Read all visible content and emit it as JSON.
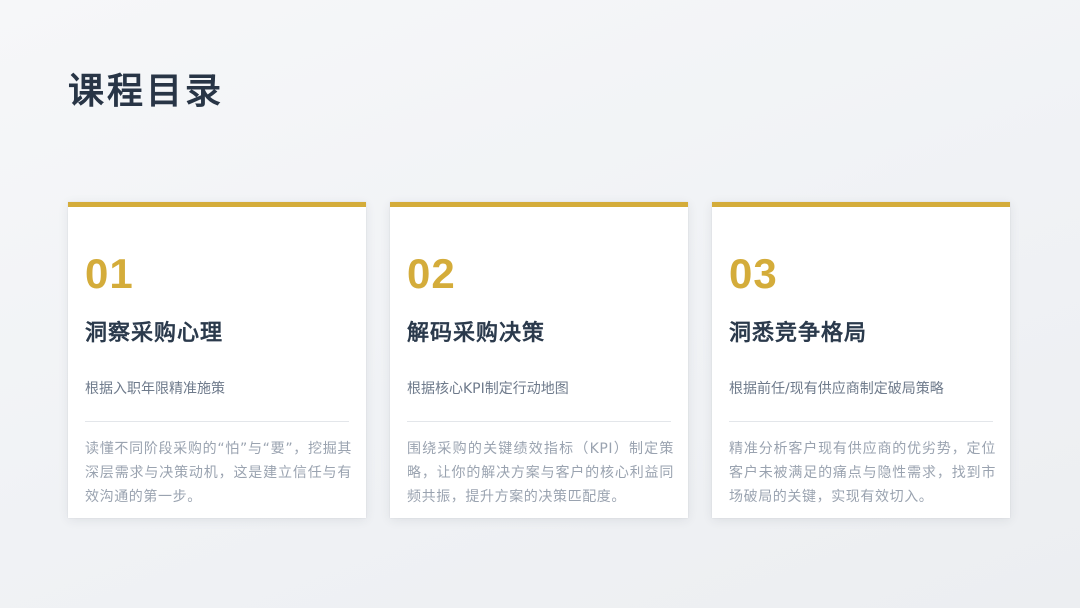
{
  "page": {
    "title": "课程目录"
  },
  "colors": {
    "accent": "#d4ac3a",
    "title": "#283546",
    "heading": "#2b3a4c",
    "subtitle": "#6e7a8b",
    "description": "#9aa3b0",
    "card_background": "#ffffff",
    "page_background": "#f2f4f6"
  },
  "cards": [
    {
      "number": "01",
      "title": "洞察采购心理",
      "subtitle": "根据入职年限精准施策",
      "description": "读懂不同阶段采购的“怕”与“要”，挖掘其深层需求与决策动机，这是建立信任与有效沟通的第一步。"
    },
    {
      "number": "02",
      "title": "解码采购决策",
      "subtitle": "根据核心KPI制定行动地图",
      "description": "围绕采购的关键绩效指标（KPI）制定策略，让你的解决方案与客户的核心利益同频共振，提升方案的决策匹配度。"
    },
    {
      "number": "03",
      "title": "洞悉竞争格局",
      "subtitle": "根据前任/现有供应商制定破局策略",
      "description": "精准分析客户现有供应商的优劣势，定位客户未被满足的痛点与隐性需求，找到市场破局的关键，实现有效切入。"
    }
  ]
}
